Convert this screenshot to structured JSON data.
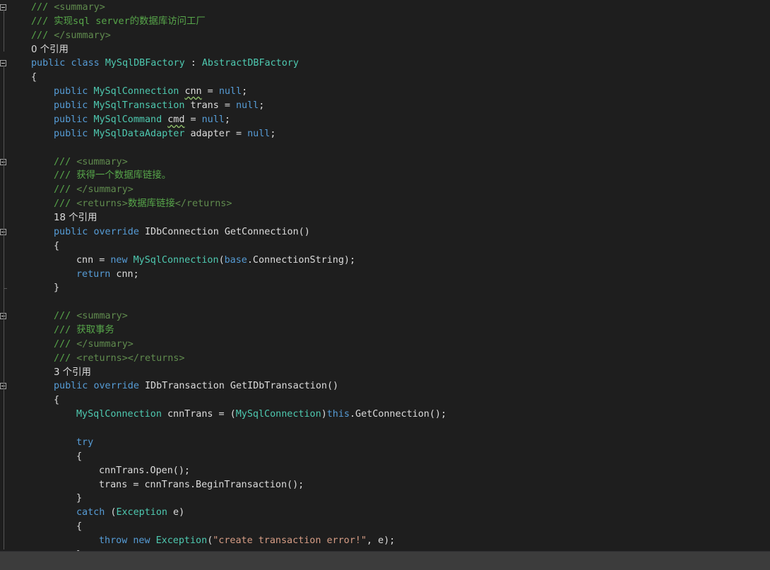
{
  "colors": {
    "background": "#1e1e1e",
    "plain": "#dcdcdc",
    "keyword": "#569cd6",
    "type": "#4ec9b0",
    "comment": "#57a64a",
    "string": "#d69d85",
    "status_bar": "#3c3c3c"
  },
  "editor": {
    "lines": [
      {
        "id": "doc-summary-open-class",
        "fold": true,
        "tokens": [
          {
            "t": "/// ",
            "c": "cm"
          },
          {
            "t": "<summary>",
            "c": "doc"
          }
        ]
      },
      {
        "id": "doc-class-desc",
        "tokens": [
          {
            "t": "/// 实现sql server的数据库访问工厂",
            "c": "cm"
          }
        ]
      },
      {
        "id": "doc-summary-close-class",
        "tokens": [
          {
            "t": "/// ",
            "c": "cm"
          },
          {
            "t": "</summary>",
            "c": "doc"
          }
        ]
      },
      {
        "id": "codelens-class",
        "lens": true,
        "tokens": [
          {
            "t": "0 个引用",
            "c": "plain"
          }
        ]
      },
      {
        "id": "class-decl",
        "fold": true,
        "tokens": [
          {
            "t": "public",
            "c": "kw"
          },
          {
            "t": " ",
            "c": "plain"
          },
          {
            "t": "class",
            "c": "kw"
          },
          {
            "t": " ",
            "c": "plain"
          },
          {
            "t": "MySqlDBFactory",
            "c": "type"
          },
          {
            "t": " : ",
            "c": "plain"
          },
          {
            "t": "AbstractDBFactory",
            "c": "type"
          }
        ]
      },
      {
        "id": "class-brace-open",
        "tokens": [
          {
            "t": "{",
            "c": "plain"
          }
        ]
      },
      {
        "id": "field-cnn",
        "indent": 1,
        "tokens": [
          {
            "t": "public",
            "c": "kw"
          },
          {
            "t": " ",
            "c": "plain"
          },
          {
            "t": "MySqlConnection",
            "c": "type"
          },
          {
            "t": " ",
            "c": "plain"
          },
          {
            "t": "cnn",
            "c": "plain",
            "squig": true
          },
          {
            "t": " = ",
            "c": "plain"
          },
          {
            "t": "null",
            "c": "kw"
          },
          {
            "t": ";",
            "c": "plain"
          }
        ]
      },
      {
        "id": "field-trans",
        "indent": 1,
        "tokens": [
          {
            "t": "public",
            "c": "kw"
          },
          {
            "t": " ",
            "c": "plain"
          },
          {
            "t": "MySqlTransaction",
            "c": "type"
          },
          {
            "t": " trans = ",
            "c": "plain"
          },
          {
            "t": "null",
            "c": "kw"
          },
          {
            "t": ";",
            "c": "plain"
          }
        ]
      },
      {
        "id": "field-cmd",
        "indent": 1,
        "tokens": [
          {
            "t": "public",
            "c": "kw"
          },
          {
            "t": " ",
            "c": "plain"
          },
          {
            "t": "MySqlCommand",
            "c": "type"
          },
          {
            "t": " ",
            "c": "plain"
          },
          {
            "t": "cmd",
            "c": "plain",
            "squig": true
          },
          {
            "t": " = ",
            "c": "plain"
          },
          {
            "t": "null",
            "c": "kw"
          },
          {
            "t": ";",
            "c": "plain"
          }
        ]
      },
      {
        "id": "field-adapter",
        "indent": 1,
        "tokens": [
          {
            "t": "public",
            "c": "kw"
          },
          {
            "t": " ",
            "c": "plain"
          },
          {
            "t": "MySqlDataAdapter",
            "c": "type"
          },
          {
            "t": " adapter = ",
            "c": "plain"
          },
          {
            "t": "null",
            "c": "kw"
          },
          {
            "t": ";",
            "c": "plain"
          }
        ]
      },
      {
        "id": "blank-1",
        "tokens": []
      },
      {
        "id": "doc-summary-open-getconn",
        "fold": true,
        "indent": 1,
        "tokens": [
          {
            "t": "/// ",
            "c": "cm"
          },
          {
            "t": "<summary>",
            "c": "doc"
          }
        ]
      },
      {
        "id": "doc-getconn-desc",
        "indent": 1,
        "tokens": [
          {
            "t": "/// 获得一个数据库链接。",
            "c": "cm"
          }
        ]
      },
      {
        "id": "doc-summary-close-getconn",
        "indent": 1,
        "tokens": [
          {
            "t": "/// ",
            "c": "cm"
          },
          {
            "t": "</summary>",
            "c": "doc"
          }
        ]
      },
      {
        "id": "doc-returns-getconn",
        "indent": 1,
        "tokens": [
          {
            "t": "/// ",
            "c": "cm"
          },
          {
            "t": "<returns>",
            "c": "doc"
          },
          {
            "t": "数据库链接",
            "c": "cm"
          },
          {
            "t": "</returns>",
            "c": "doc"
          }
        ]
      },
      {
        "id": "codelens-getconn",
        "lens": true,
        "indent": 1,
        "tokens": [
          {
            "t": "18 个引用",
            "c": "plain"
          }
        ]
      },
      {
        "id": "method-getconn-decl",
        "fold": true,
        "indent": 1,
        "tokens": [
          {
            "t": "public",
            "c": "kw"
          },
          {
            "t": " ",
            "c": "plain"
          },
          {
            "t": "override",
            "c": "kw"
          },
          {
            "t": " IDbConnection GetConnection()",
            "c": "plain"
          }
        ]
      },
      {
        "id": "getconn-brace-open",
        "indent": 1,
        "tokens": [
          {
            "t": "{",
            "c": "plain"
          }
        ]
      },
      {
        "id": "getconn-assign",
        "indent": 2,
        "tokens": [
          {
            "t": "cnn = ",
            "c": "plain"
          },
          {
            "t": "new",
            "c": "kw"
          },
          {
            "t": " ",
            "c": "plain"
          },
          {
            "t": "MySqlConnection",
            "c": "type"
          },
          {
            "t": "(",
            "c": "plain"
          },
          {
            "t": "base",
            "c": "kw"
          },
          {
            "t": ".ConnectionString);",
            "c": "plain"
          }
        ]
      },
      {
        "id": "getconn-return",
        "indent": 2,
        "tokens": [
          {
            "t": "return",
            "c": "kw"
          },
          {
            "t": " cnn;",
            "c": "plain"
          }
        ]
      },
      {
        "id": "getconn-brace-close",
        "indent": 1,
        "foldEnd": true,
        "tokens": [
          {
            "t": "}",
            "c": "plain"
          }
        ]
      },
      {
        "id": "blank-2",
        "tokens": []
      },
      {
        "id": "doc-summary-open-gettrans",
        "fold": true,
        "indent": 1,
        "tokens": [
          {
            "t": "/// ",
            "c": "cm"
          },
          {
            "t": "<summary>",
            "c": "doc"
          }
        ]
      },
      {
        "id": "doc-gettrans-desc",
        "indent": 1,
        "tokens": [
          {
            "t": "/// 获取事务",
            "c": "cm"
          }
        ]
      },
      {
        "id": "doc-summary-close-gettrans",
        "indent": 1,
        "tokens": [
          {
            "t": "/// ",
            "c": "cm"
          },
          {
            "t": "</summary>",
            "c": "doc"
          }
        ]
      },
      {
        "id": "doc-returns-gettrans",
        "indent": 1,
        "tokens": [
          {
            "t": "/// ",
            "c": "cm"
          },
          {
            "t": "<returns></returns>",
            "c": "doc"
          }
        ]
      },
      {
        "id": "codelens-gettrans",
        "lens": true,
        "indent": 1,
        "tokens": [
          {
            "t": "3 个引用",
            "c": "plain"
          }
        ]
      },
      {
        "id": "method-gettrans-decl",
        "fold": true,
        "indent": 1,
        "tokens": [
          {
            "t": "public",
            "c": "kw"
          },
          {
            "t": " ",
            "c": "plain"
          },
          {
            "t": "override",
            "c": "kw"
          },
          {
            "t": " IDbTransaction GetIDbTransaction()",
            "c": "plain"
          }
        ]
      },
      {
        "id": "gettrans-brace-open",
        "indent": 1,
        "tokens": [
          {
            "t": "{",
            "c": "plain"
          }
        ]
      },
      {
        "id": "gettrans-cnntrans",
        "indent": 2,
        "tokens": [
          {
            "t": "MySqlConnection",
            "c": "type"
          },
          {
            "t": " cnnTrans = (",
            "c": "plain"
          },
          {
            "t": "MySqlConnection",
            "c": "type"
          },
          {
            "t": ")",
            "c": "plain"
          },
          {
            "t": "this",
            "c": "kw"
          },
          {
            "t": ".GetConnection();",
            "c": "plain"
          }
        ]
      },
      {
        "id": "blank-3",
        "tokens": []
      },
      {
        "id": "try-kw",
        "indent": 2,
        "tokens": [
          {
            "t": "try",
            "c": "kw"
          }
        ]
      },
      {
        "id": "try-brace-open",
        "indent": 2,
        "tokens": [
          {
            "t": "{",
            "c": "plain"
          }
        ]
      },
      {
        "id": "try-open",
        "indent": 3,
        "tokens": [
          {
            "t": "cnnTrans.Open();",
            "c": "plain"
          }
        ]
      },
      {
        "id": "try-begin",
        "indent": 3,
        "tokens": [
          {
            "t": "trans = cnnTrans.BeginTransaction();",
            "c": "plain"
          }
        ]
      },
      {
        "id": "try-brace-close",
        "indent": 2,
        "tokens": [
          {
            "t": "}",
            "c": "plain"
          }
        ]
      },
      {
        "id": "catch-kw",
        "indent": 2,
        "tokens": [
          {
            "t": "catch",
            "c": "kw"
          },
          {
            "t": " (",
            "c": "plain"
          },
          {
            "t": "Exception",
            "c": "type"
          },
          {
            "t": " e)",
            "c": "plain"
          }
        ]
      },
      {
        "id": "catch-brace-open",
        "indent": 2,
        "tokens": [
          {
            "t": "{",
            "c": "plain"
          }
        ]
      },
      {
        "id": "catch-throw",
        "indent": 3,
        "tokens": [
          {
            "t": "throw",
            "c": "kw"
          },
          {
            "t": " ",
            "c": "plain"
          },
          {
            "t": "new",
            "c": "kw"
          },
          {
            "t": " ",
            "c": "plain"
          },
          {
            "t": "Exception",
            "c": "type"
          },
          {
            "t": "(",
            "c": "plain"
          },
          {
            "t": "\"create transaction error!\"",
            "c": "str"
          },
          {
            "t": ", e);",
            "c": "plain"
          }
        ]
      },
      {
        "id": "catch-brace-close",
        "indent": 2,
        "tokens": [
          {
            "t": "}",
            "c": "plain"
          }
        ]
      }
    ]
  },
  "status_bar": {
    "text": ""
  }
}
